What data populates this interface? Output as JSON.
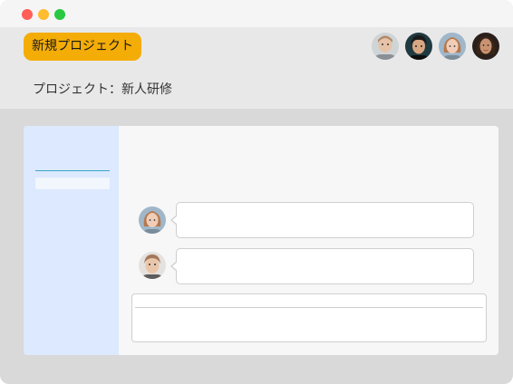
{
  "header": {
    "new_project_label": "新規プロジェクト",
    "project_label": "プロジェクト：新人研修"
  },
  "members": [
    {
      "name": "member-1",
      "icon": "person-photo",
      "hair": "#b08a6a",
      "skin": "#e6c3a8",
      "bg": "#cfd4d6"
    },
    {
      "name": "member-2",
      "icon": "person-photo",
      "hair": "#1a1a1a",
      "skin": "#d8a782",
      "bg": "#1f3a40"
    },
    {
      "name": "member-3",
      "icon": "person-photo",
      "hair": "#b5784e",
      "skin": "#f1cdb8",
      "bg": "#9fb7c9"
    },
    {
      "name": "member-4",
      "icon": "person-photo",
      "hair": "#3a2418",
      "skin": "#c99372",
      "bg": "#2a1f1a"
    }
  ],
  "sidebar": {
    "search_placeholder": ""
  },
  "messages": [
    {
      "author_icon": "person-photo",
      "text": ""
    },
    {
      "author_icon": "person-photo",
      "text": ""
    }
  ],
  "composer": {
    "subject_placeholder": "",
    "body_placeholder": ""
  },
  "colors": {
    "accent": "#f4ac07",
    "sidebar": "#dce9ff",
    "divider": "#3aa6c9"
  }
}
